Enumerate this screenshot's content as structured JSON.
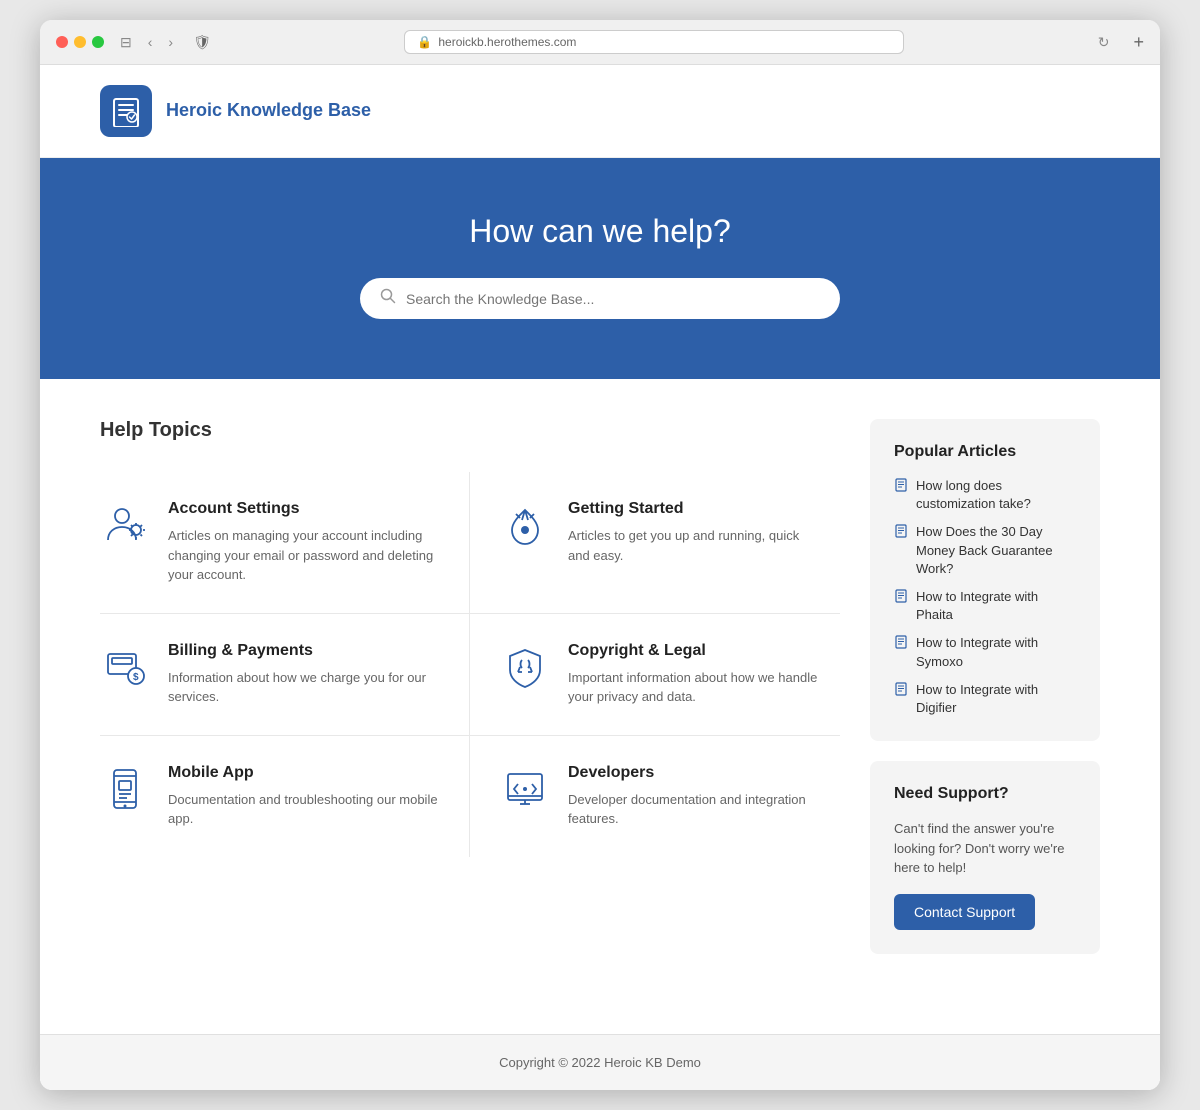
{
  "browser": {
    "url": "heroickb.herothemes.com",
    "security_icon": "🛡",
    "reload_icon": "↻",
    "new_tab": "+"
  },
  "header": {
    "logo_icon": "📘",
    "brand_name": "Heroic Knowledge Base"
  },
  "hero": {
    "title": "How can we help?",
    "search_placeholder": "Search the Knowledge Base..."
  },
  "help_topics": {
    "section_title": "Help Topics",
    "topics": [
      {
        "id": "account-settings",
        "title": "Account Settings",
        "description": "Articles on managing your account including changing your email or password and deleting your account."
      },
      {
        "id": "getting-started",
        "title": "Getting Started",
        "description": "Articles to get you up and running, quick and easy."
      },
      {
        "id": "billing-payments",
        "title": "Billing & Payments",
        "description": "Information about how we charge you for our services."
      },
      {
        "id": "copyright-legal",
        "title": "Copyright & Legal",
        "description": "Important information about how we handle your privacy and data."
      },
      {
        "id": "mobile-app",
        "title": "Mobile App",
        "description": "Documentation and troubleshooting our mobile app."
      },
      {
        "id": "developers",
        "title": "Developers",
        "description": "Developer documentation and integration features."
      }
    ]
  },
  "popular_articles": {
    "title": "Popular Articles",
    "articles": [
      "How long does customization take?",
      "How Does the 30 Day Money Back Guarantee Work?",
      "How to Integrate with Phaita",
      "How to Integrate with Symoxo",
      "How to Integrate with Digifier"
    ]
  },
  "support": {
    "title": "Need Support?",
    "description": "Can't find the answer you're looking for? Don't worry we're here to help!",
    "button_label": "Contact Support"
  },
  "footer": {
    "text": "Copyright © 2022 Heroic KB Demo"
  },
  "colors": {
    "primary": "#2d5fa8",
    "bg": "#f4f4f4"
  }
}
